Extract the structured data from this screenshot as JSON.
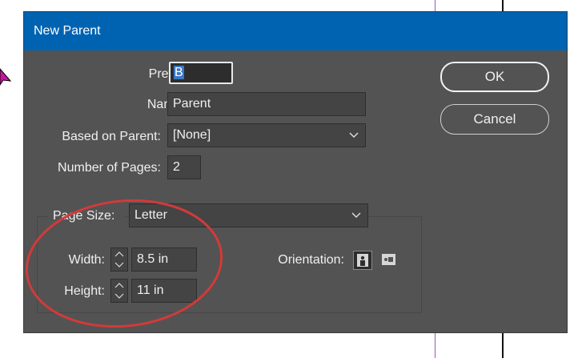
{
  "dialog": {
    "title": "New Parent",
    "prefix": {
      "label": "Prefix:",
      "value": "B"
    },
    "name": {
      "label": "Name:",
      "value": "Parent"
    },
    "based_on": {
      "label": "Based on Parent:",
      "value": "[None]"
    },
    "pages": {
      "label": "Number of Pages:",
      "value": "2"
    },
    "page_size": {
      "label": "Page Size:",
      "value": "Letter"
    },
    "width": {
      "label": "Width:",
      "value": "8.5 in"
    },
    "height": {
      "label": "Height:",
      "value": "11 in"
    },
    "orientation": {
      "label": "Orientation:",
      "selected": "portrait"
    },
    "buttons": {
      "ok": "OK",
      "cancel": "Cancel"
    }
  },
  "colors": {
    "titlebar": "#0063b1",
    "dialog_bg": "#535353",
    "annotation_ellipse": "#d23a3a",
    "cursor": "#c6179c"
  },
  "icons": [
    "chevron-down-icon",
    "stepper-icon",
    "portrait-orientation-icon",
    "landscape-orientation-icon",
    "mouse-cursor-icon"
  ]
}
